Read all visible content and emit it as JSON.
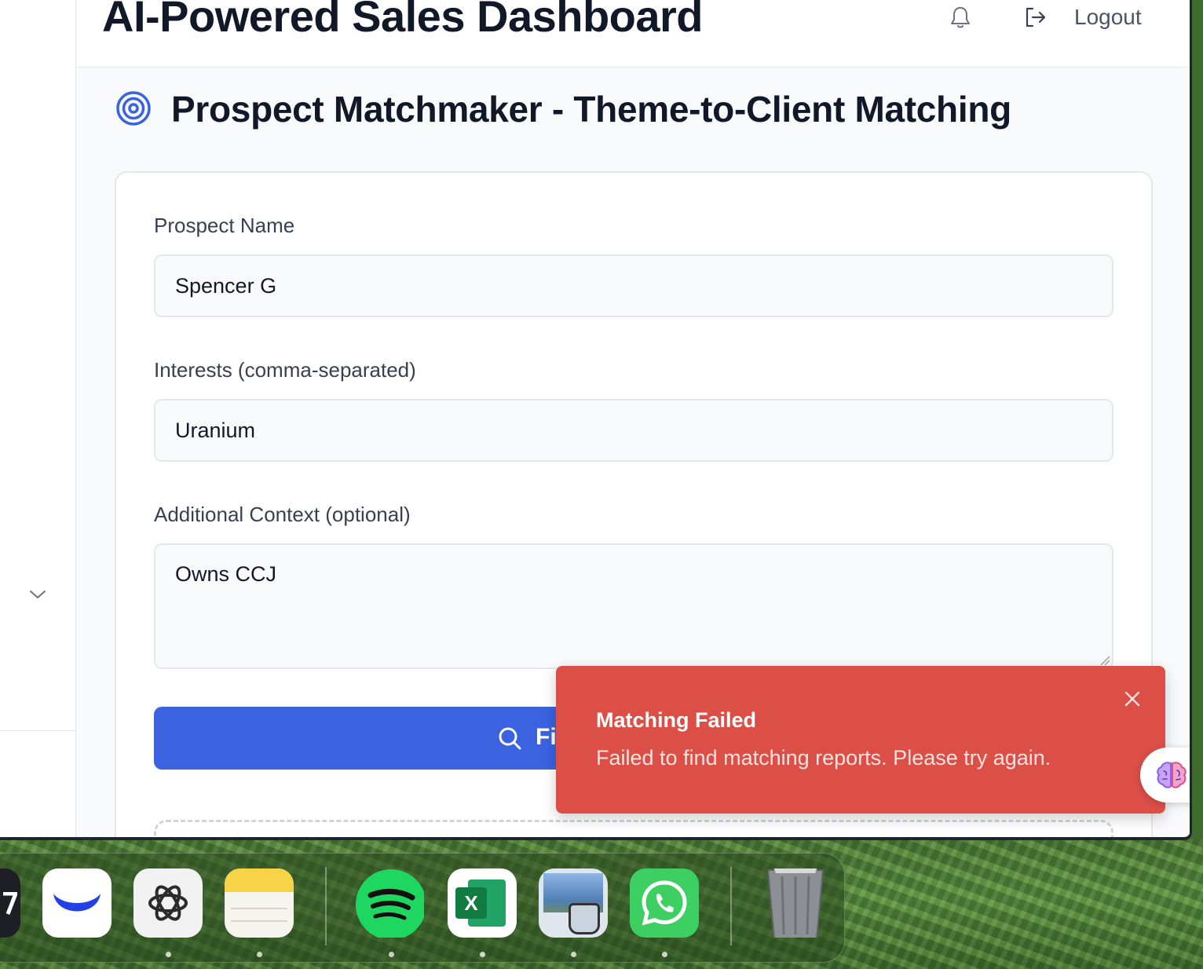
{
  "header": {
    "title": "AI-Powered Sales Dashboard",
    "logout_label": "Logout"
  },
  "page": {
    "title": "Prospect Matchmaker - Theme-to-Client Matching"
  },
  "form": {
    "prospect_name_label": "Prospect Name",
    "prospect_name_value": "Spencer G",
    "interests_label": "Interests (comma-separated)",
    "interests_value": "Uranium",
    "context_label": "Additional Context (optional)",
    "context_value": "Owns CCJ",
    "find_button_label": "Fi"
  },
  "toast": {
    "title": "Matching Failed",
    "message": "Failed to find matching reports. Please try again."
  },
  "colors": {
    "primary": "#3b63e0",
    "error": "#dc4f47",
    "text": "#111827"
  },
  "dock": {
    "apps": [
      "partial-app",
      "webull",
      "chatgpt",
      "notes",
      "spotify",
      "excel",
      "preview",
      "whatsapp",
      "trash"
    ]
  }
}
